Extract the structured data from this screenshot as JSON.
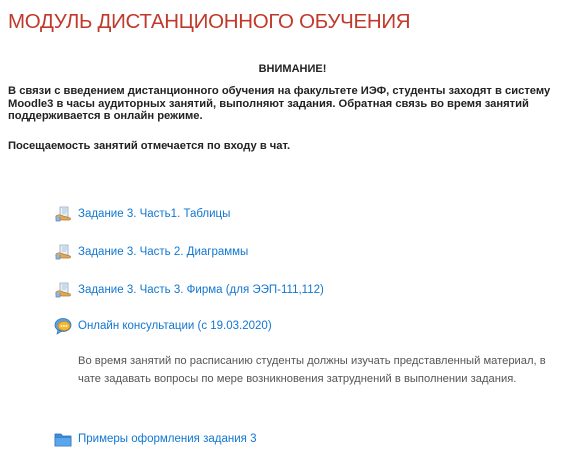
{
  "page": {
    "title": "МОДУЛЬ ДИСТАНЦИОННОГО ОБУЧЕНИЯ"
  },
  "notice": {
    "heading": "ВНИМАНИЕ!",
    "body": "В связи с введением дистанционного обучения на факультете ИЭФ,  студенты заходят в систему Moodle3 в часы аудиторных занятий, выполняют задания. Обратная связь во время занятий поддерживается в онлайн режиме.",
    "attendance": "Посещаемость занятий отмечается по входу в чат."
  },
  "activities": [
    {
      "label": "Задание 3. Часть1. Таблицы",
      "icon": "assignment-icon"
    },
    {
      "label": "Задание 3. Часть 2. Диаграммы",
      "icon": "assignment-icon"
    },
    {
      "label": "Задание 3. Часть 3. Фирма (для ЭЭП-111,112)",
      "icon": "assignment-icon"
    },
    {
      "label": "Онлайн консультации (с 19.03.2020)",
      "icon": "chat-icon"
    },
    {
      "label": "Примеры оформления задания 3",
      "icon": "folder-icon"
    }
  ],
  "chat_description": "Во время занятий по расписанию студенты должны изучать представленный материал, в чате задавать вопросы по мере возникновения затруднений в выполнении задания.",
  "colors": {
    "title": "#c0392b",
    "link": "#1177d1",
    "text": "#222222",
    "muted": "#555555"
  }
}
